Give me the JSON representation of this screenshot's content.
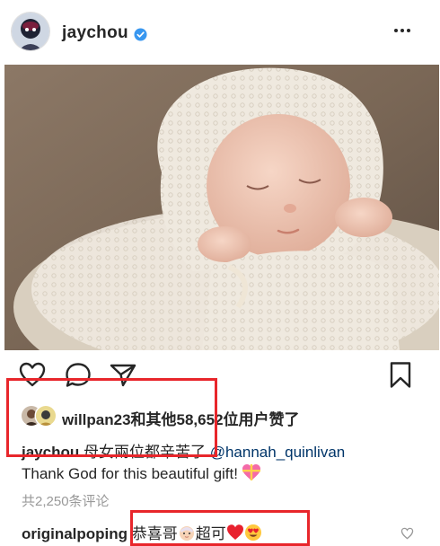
{
  "post": {
    "username": "jaychou",
    "verified": true,
    "photo_alt": "newborn baby in lace bonnet"
  },
  "actions": {
    "like_icon": "heart-outline-icon",
    "comment_icon": "comment-bubble-icon",
    "share_icon": "paper-plane-icon",
    "save_icon": "bookmark-icon"
  },
  "likes": {
    "text": "willpan23和其他58,652位用户赞了"
  },
  "caption": {
    "user": "jaychou",
    "text": " 母女兩位都辛苦了 ",
    "mention": "@hannah_quinlivan",
    "line2": "Thank God for this beautiful gift!"
  },
  "comments": {
    "count_text": "共2,250条评论",
    "items": [
      {
        "user": "originalpoping",
        "text_a": " 恭喜哥",
        "text_b": "超可"
      }
    ]
  },
  "colors": {
    "annotation": "#e8262b",
    "verified": "#3897f0",
    "link": "#003569",
    "muted": "#999999"
  }
}
